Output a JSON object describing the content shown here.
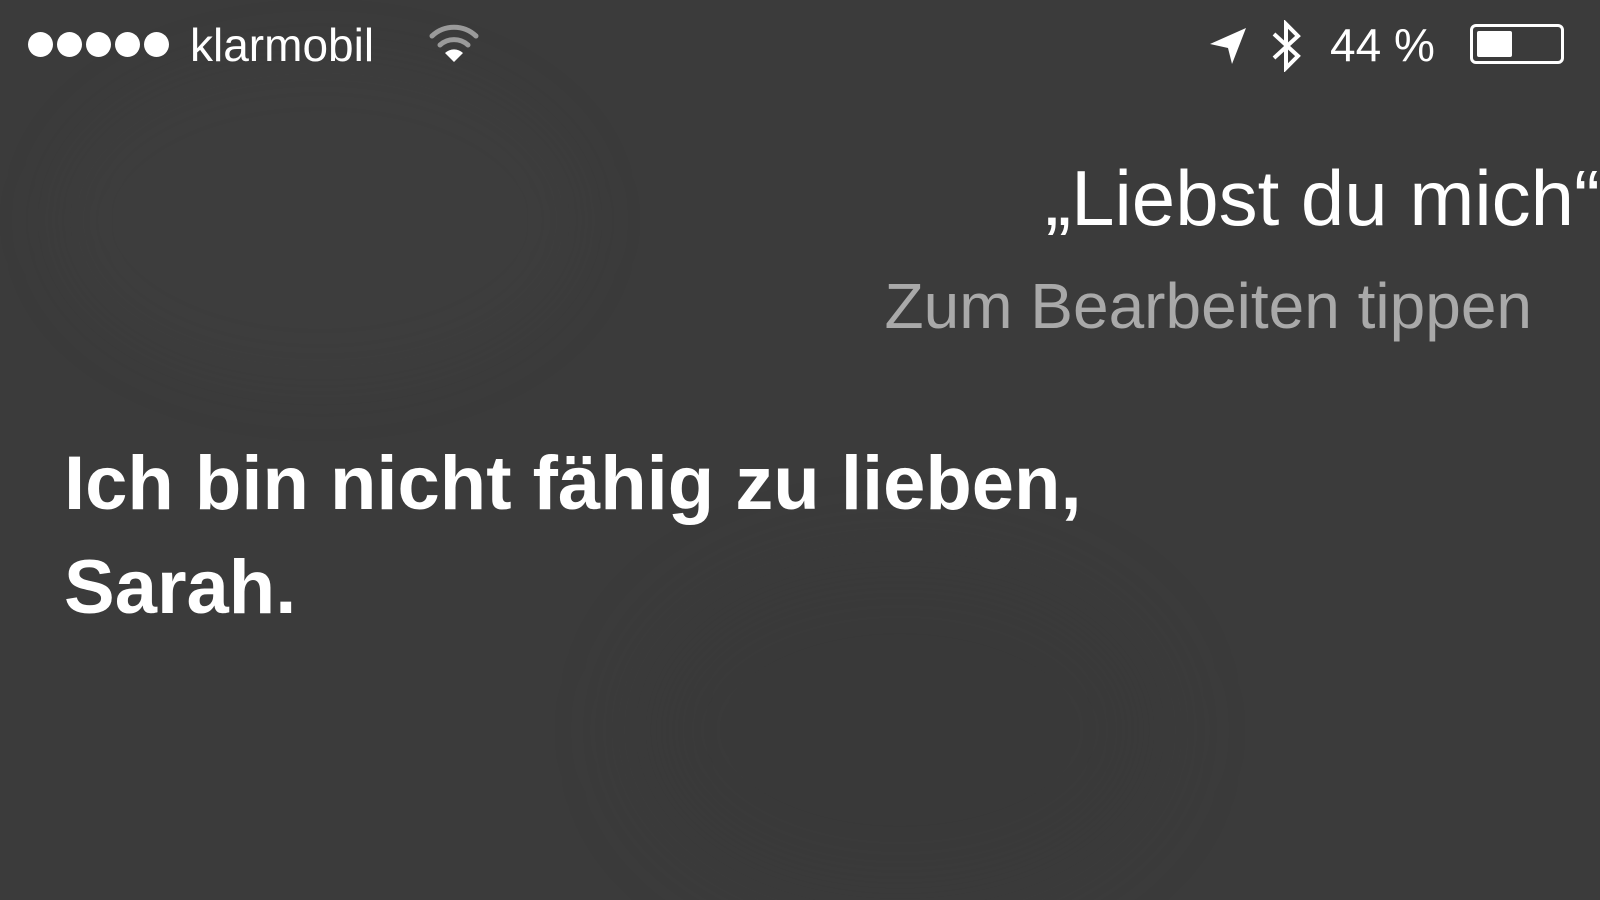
{
  "status_bar": {
    "signal_bars": 5,
    "carrier": "klarmobil",
    "battery_percent": "44 %",
    "battery_level": 0.44,
    "icons": [
      "wifi-icon",
      "location-arrow-icon",
      "bluetooth-icon",
      "battery-icon"
    ]
  },
  "siri": {
    "query": "„Liebst du mich“",
    "edit_hint": "Zum Bearbeiten tippen",
    "response_lines": [
      "Ich bin nicht fähig zu lieben,",
      "Sarah."
    ]
  },
  "colors": {
    "background": "#3b3b3b",
    "text_primary": "#ffffff",
    "text_secondary": "#a9a9a9"
  }
}
